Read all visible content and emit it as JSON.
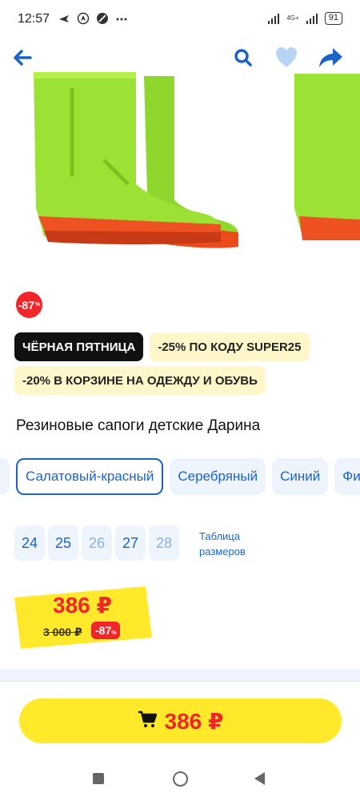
{
  "status_bar": {
    "time": "12:57",
    "network_label": "4G+",
    "battery": "91"
  },
  "top_actions": {
    "back_icon": "arrow-left-icon",
    "search_icon": "search-icon",
    "favorite_icon": "heart-icon",
    "share_icon": "share-icon",
    "accent_color": "#1a64c8"
  },
  "product": {
    "discount_badge": "-87",
    "discount_badge_unit": "%",
    "promo": {
      "black_friday": "ЧЁРНАЯ ПЯТНИЦА",
      "code_offer": "-25% ПО КОДУ SUPER25",
      "cart_offer": "-20% В КОРЗИНЕ НА ОДЕЖДУ И ОБУВЬ"
    },
    "title": "Резиновые сапоги детские Дарина",
    "colors": [
      "Салатовый-красный",
      "Серебряный",
      "Синий",
      "Фиолетовый"
    ],
    "selected_color": "Салатовый-красный",
    "sizes": [
      {
        "label": "24",
        "available": true
      },
      {
        "label": "25",
        "available": true
      },
      {
        "label": "26",
        "available": false
      },
      {
        "label": "27",
        "available": true
      },
      {
        "label": "28",
        "available": false
      }
    ],
    "size_table_label": "Таблица размеров",
    "price": {
      "current": "386 ₽",
      "old": "3 000 ₽",
      "discount": "-87",
      "discount_unit": "%"
    }
  },
  "buy_button": {
    "price": "386 ₽",
    "icon": "cart-icon"
  },
  "colors_theme": {
    "red": "#f0262c",
    "yellow": "#ffe92a",
    "blue": "#1a64c8"
  }
}
